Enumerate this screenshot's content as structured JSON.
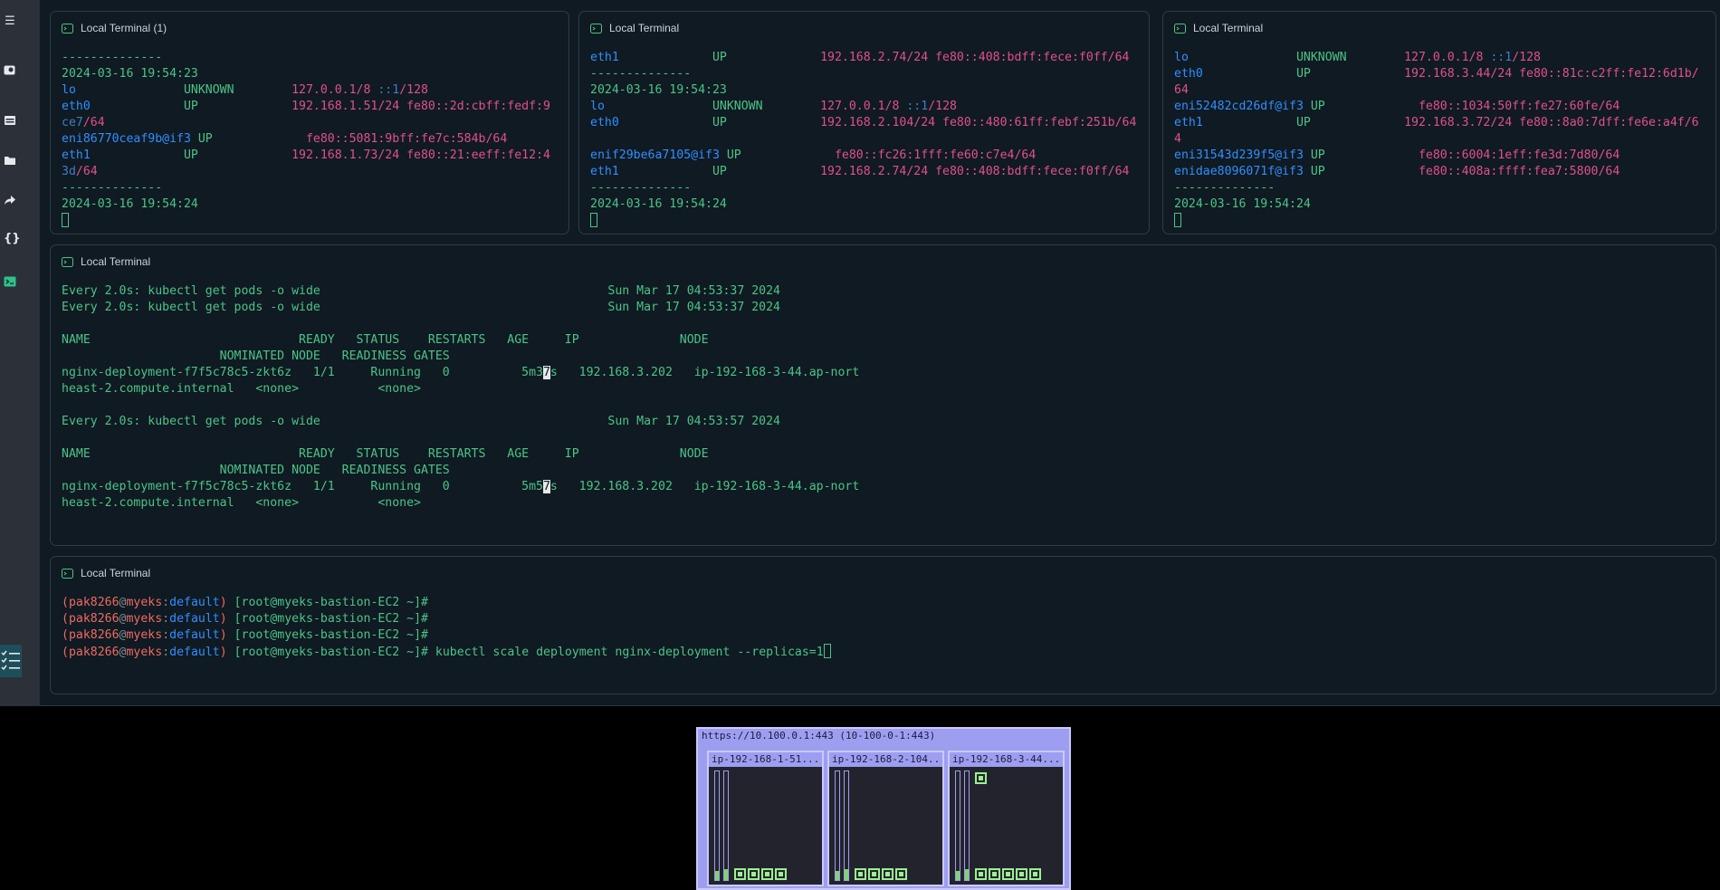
{
  "panels": {
    "t1": {
      "title": "Local Terminal (1)",
      "lines": [
        [
          {
            "t": "--------------"
          }
        ],
        [
          {
            "t": "2024-03-16 19:54:23"
          }
        ],
        [
          {
            "t": "lo               ",
            "c": "c-blue"
          },
          {
            "t": "UNKNOWN        "
          },
          {
            "t": "127.0.0.1/8 ",
            "c": "c-pink"
          },
          {
            "t": "::1",
            "c": "c-teal"
          },
          {
            "t": "/128",
            "c": "c-pink"
          }
        ],
        [
          {
            "t": "eth0             ",
            "c": "c-blue"
          },
          {
            "t": "UP             "
          },
          {
            "t": "192.168.1.51/24 fe80::2d:cbff:fedf:9",
            "c": "c-pink"
          }
        ],
        [
          {
            "t": "ce7",
            "c": "c-teal"
          },
          {
            "t": "/64",
            "c": "c-pink"
          }
        ],
        [
          {
            "t": "eni86770ceaf9b@if3 ",
            "c": "c-blue"
          },
          {
            "t": "UP             "
          },
          {
            "t": "fe80::5081:9bff:fe7c:584b/64",
            "c": "c-pink"
          }
        ],
        [
          {
            "t": "eth1             ",
            "c": "c-blue"
          },
          {
            "t": "UP             "
          },
          {
            "t": "192.168.1.73/24 fe80::21:eeff:fe12:4",
            "c": "c-pink"
          }
        ],
        [
          {
            "t": "3d",
            "c": "c-teal"
          },
          {
            "t": "/64",
            "c": "c-pink"
          }
        ],
        [
          {
            "t": "--------------"
          }
        ],
        [
          {
            "t": "2024-03-16 19:54:24"
          }
        ]
      ]
    },
    "t2": {
      "title": "Local Terminal",
      "lines": [
        [
          {
            "t": "eth1             ",
            "c": "c-blue"
          },
          {
            "t": "UP             "
          },
          {
            "t": "192.168.2.74/24 fe80::408:bdff:fece:f0ff/64",
            "c": "c-pink"
          }
        ],
        [
          {
            "t": "--------------"
          }
        ],
        [
          {
            "t": "2024-03-16 19:54:23"
          }
        ],
        [
          {
            "t": "lo               ",
            "c": "c-blue"
          },
          {
            "t": "UNKNOWN        "
          },
          {
            "t": "127.0.0.1/8 ",
            "c": "c-pink"
          },
          {
            "t": "::1",
            "c": "c-teal"
          },
          {
            "t": "/128",
            "c": "c-pink"
          }
        ],
        [
          {
            "t": "eth0             ",
            "c": "c-blue"
          },
          {
            "t": "UP             "
          },
          {
            "t": "192.168.2.104/24 fe80::480:61ff:febf:251b/64",
            "c": "c-pink"
          }
        ],
        [
          {
            "t": ""
          }
        ],
        [
          {
            "t": "enif29be6a7105@if3 ",
            "c": "c-blue"
          },
          {
            "t": "UP             "
          },
          {
            "t": "fe80::fc26:1fff:fe60:c7e4/64",
            "c": "c-pink"
          }
        ],
        [
          {
            "t": "eth1             ",
            "c": "c-blue"
          },
          {
            "t": "UP             "
          },
          {
            "t": "192.168.2.74/24 fe80::408:bdff:fece:f0ff/64",
            "c": "c-pink"
          }
        ],
        [
          {
            "t": "--------------"
          }
        ],
        [
          {
            "t": "2024-03-16 19:54:24"
          }
        ]
      ]
    },
    "t3": {
      "title": "Local Terminal",
      "lines": [
        [
          {
            "t": "lo               ",
            "c": "c-blue"
          },
          {
            "t": "UNKNOWN        "
          },
          {
            "t": "127.0.0.1/8 ",
            "c": "c-pink"
          },
          {
            "t": "::1",
            "c": "c-teal"
          },
          {
            "t": "/128",
            "c": "c-pink"
          }
        ],
        [
          {
            "t": "eth0             ",
            "c": "c-blue"
          },
          {
            "t": "UP             "
          },
          {
            "t": "192.168.3.44/24 fe80::81c:c2ff:fe12:6d1b/",
            "c": "c-pink"
          }
        ],
        [
          {
            "t": "64",
            "c": "c-pink"
          }
        ],
        [
          {
            "t": "eni52482cd26df@if3 ",
            "c": "c-blue"
          },
          {
            "t": "UP             "
          },
          {
            "t": "fe80::1034:50ff:fe27:60fe/64",
            "c": "c-pink"
          }
        ],
        [
          {
            "t": "eth1             ",
            "c": "c-blue"
          },
          {
            "t": "UP             "
          },
          {
            "t": "192.168.3.72/24 fe80::8a0:7dff:fe6e:a4f/6",
            "c": "c-pink"
          }
        ],
        [
          {
            "t": "4",
            "c": "c-pink"
          }
        ],
        [
          {
            "t": "eni31543d239f5@if3 ",
            "c": "c-blue"
          },
          {
            "t": "UP             "
          },
          {
            "t": "fe80::6004:1eff:fe3d:7d80/64",
            "c": "c-pink"
          }
        ],
        [
          {
            "t": "enidae8096071f@if3 ",
            "c": "c-blue"
          },
          {
            "t": "UP             "
          },
          {
            "t": "fe80::408a:ffff:fea7:5800/64",
            "c": "c-pink"
          }
        ],
        [
          {
            "t": "--------------"
          }
        ],
        [
          {
            "t": "2024-03-16 19:54:24"
          }
        ]
      ]
    },
    "t4": {
      "title": "Local Terminal",
      "lines": [
        [
          {
            "t": "Every 2.0s: kubectl get pods -o wide                                        Sun Mar 17 04:53:37 2024"
          }
        ],
        [
          {
            "t": "Every 2.0s: kubectl get pods -o wide                                        Sun Mar 17 04:53:37 2024"
          }
        ],
        [
          {
            "t": ""
          }
        ],
        [
          {
            "t": "NAME                             READY   STATUS    RESTARTS   AGE     IP              NODE"
          }
        ],
        [
          {
            "t": "                      NOMINATED NODE   READINESS GATES"
          }
        ],
        [
          {
            "t": "nginx-deployment-f7f5c78c5-zkt6z   1/1     Running   0          5m3"
          },
          {
            "t": "7",
            "c": "hlchar"
          },
          {
            "t": "s   192.168.3.202   ip-192-168-3-44.ap-nort"
          }
        ],
        [
          {
            "t": "heast-2.compute.internal   <none>           <none>"
          }
        ],
        [
          {
            "t": ""
          }
        ],
        [
          {
            "t": "Every 2.0s: kubectl get pods -o wide                                        Sun Mar 17 04:53:57 2024"
          }
        ],
        [
          {
            "t": ""
          }
        ],
        [
          {
            "t": "NAME                             READY   STATUS    RESTARTS   AGE     IP              NODE"
          }
        ],
        [
          {
            "t": "                      NOMINATED NODE   READINESS GATES"
          }
        ],
        [
          {
            "t": "nginx-deployment-f7f5c78c5-zkt6z   1/1     Running   0          5m5"
          },
          {
            "t": "7",
            "c": "hlchar"
          },
          {
            "t": "s   192.168.3.202   ip-192-168-3-44.ap-nort"
          }
        ],
        [
          {
            "t": "heast-2.compute.internal   <none>           <none>"
          }
        ]
      ]
    },
    "t5": {
      "title": "Local Terminal",
      "lines": [
        [
          {
            "t": "(",
            "c": "c-red"
          },
          {
            "t": "pak8266",
            "c": "c-red"
          },
          {
            "t": "@",
            "c": "c-gray"
          },
          {
            "t": "myeks",
            "c": "c-red"
          },
          {
            "t": ":",
            "c": "c-gray"
          },
          {
            "t": "default",
            "c": "c-blue"
          },
          {
            "t": ")",
            "c": "c-red"
          },
          {
            "t": " [root@myeks-bastion-EC2 ~]#"
          }
        ],
        [
          {
            "t": "(",
            "c": "c-red"
          },
          {
            "t": "pak8266",
            "c": "c-red"
          },
          {
            "t": "@",
            "c": "c-gray"
          },
          {
            "t": "myeks",
            "c": "c-red"
          },
          {
            "t": ":",
            "c": "c-gray"
          },
          {
            "t": "default",
            "c": "c-blue"
          },
          {
            "t": ")",
            "c": "c-red"
          },
          {
            "t": " [root@myeks-bastion-EC2 ~]#"
          }
        ],
        [
          {
            "t": "(",
            "c": "c-red"
          },
          {
            "t": "pak8266",
            "c": "c-red"
          },
          {
            "t": "@",
            "c": "c-gray"
          },
          {
            "t": "myeks",
            "c": "c-red"
          },
          {
            "t": ":",
            "c": "c-gray"
          },
          {
            "t": "default",
            "c": "c-blue"
          },
          {
            "t": ")",
            "c": "c-red"
          },
          {
            "t": " [root@myeks-bastion-EC2 ~]#"
          }
        ],
        [
          {
            "t": "(",
            "c": "c-red"
          },
          {
            "t": "pak8266",
            "c": "c-red"
          },
          {
            "t": "@",
            "c": "c-gray"
          },
          {
            "t": "myeks",
            "c": "c-red"
          },
          {
            "t": ":",
            "c": "c-gray"
          },
          {
            "t": "default",
            "c": "c-blue"
          },
          {
            "t": ")",
            "c": "c-red"
          },
          {
            "t": " [root@myeks-bastion-EC2 ~]# kubectl scale deployment nginx-deployment --replicas=1"
          }
        ]
      ]
    }
  },
  "kube_ops_view": {
    "title": "https://10.100.0.1:443 (10-100-0-1:443)",
    "nodes": [
      {
        "label": "ip-192-168-1-51...",
        "bar_fill": [
          0.08,
          0.1
        ],
        "pod_count": 4
      },
      {
        "label": "ip-192-168-2-104...",
        "bar_fill": [
          0.08,
          0.1
        ],
        "pod_count": 4
      },
      {
        "label": "ip-192-168-3-44...",
        "bar_fill": [
          0.08,
          0.1
        ],
        "pod_count": 5,
        "extra_pod": true
      }
    ]
  },
  "sidebar": {
    "icons": [
      "menu-icon",
      "terminal-search-icon",
      "table-icon",
      "folder-icon",
      "share-icon",
      "code-braces-icon",
      "terminal-icon",
      "checklist-icon"
    ]
  }
}
